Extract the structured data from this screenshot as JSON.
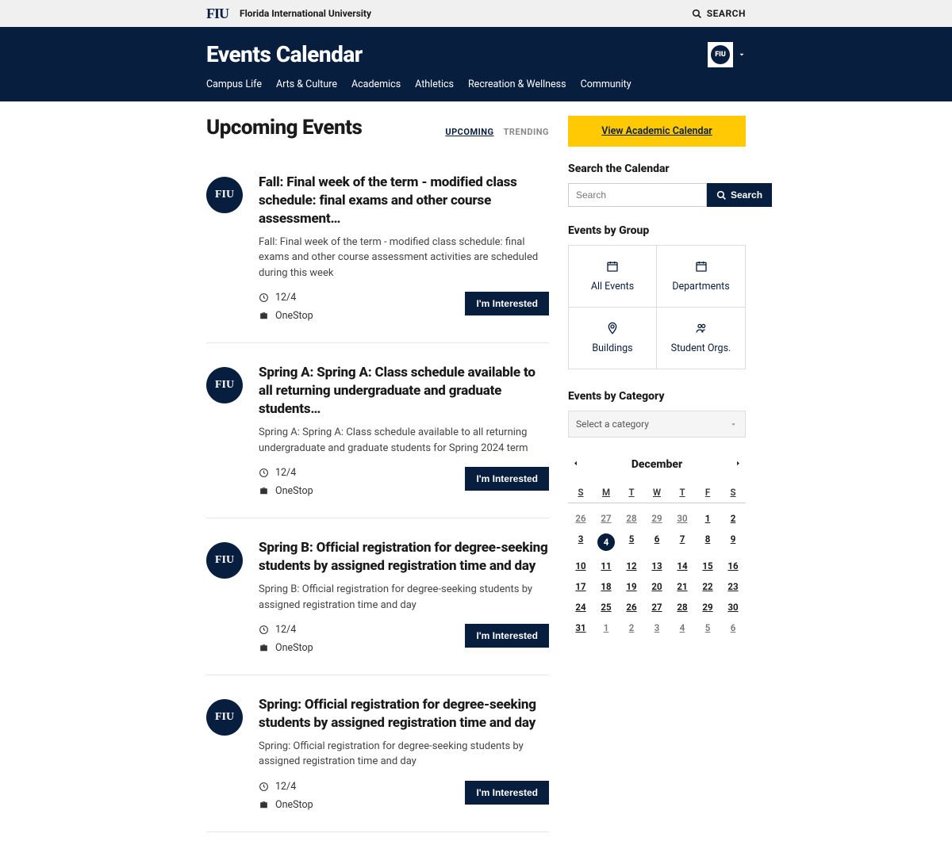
{
  "topbar": {
    "logo_text": "FIU",
    "university_name": "Florida International University",
    "search_label": "SEARCH"
  },
  "header": {
    "site_title": "Events Calendar",
    "avatar_text": "FIU",
    "nav": [
      "Campus Life",
      "Arts & Culture",
      "Academics",
      "Athletics",
      "Recreation & Wellness",
      "Community"
    ]
  },
  "main": {
    "page_title": "Upcoming Events",
    "tabs": {
      "upcoming": "UPCOMING",
      "trending": "TRENDING"
    },
    "events": [
      {
        "title": "Fall: Final week of the term - modified class schedule: final exams and other course assessment…",
        "desc": "Fall: Final week of the term - modified class schedule: final exams and other course assessment activities are scheduled during this week",
        "date": "12/4",
        "org": "OneStop",
        "btn": "I'm Interested"
      },
      {
        "title": "Spring A: Spring A: Class schedule available to all returning undergraduate and graduate students…",
        "desc": "Spring A: Spring A: Class schedule available to all returning undergraduate and graduate students for Spring 2024 term",
        "date": "12/4",
        "org": "OneStop",
        "btn": "I'm Interested"
      },
      {
        "title": "Spring B: Official registration for degree-seeking students by assigned registration time and day",
        "desc": "Spring B: Official registration for degree-seeking students by assigned registration time and day",
        "date": "12/4",
        "org": "OneStop",
        "btn": "I'm Interested"
      },
      {
        "title": "Spring: Official registration for degree-seeking students by assigned registration time and day",
        "desc": "Spring: Official registration for degree-seeking students by assigned registration time and day",
        "date": "12/4",
        "org": "OneStop",
        "btn": "I'm Interested"
      }
    ]
  },
  "sidebar": {
    "academic_btn": "View Academic Calendar",
    "search_heading": "Search the Calendar",
    "search_placeholder": "Search",
    "search_btn": "Search",
    "groups_heading": "Events by Group",
    "groups": [
      "All Events",
      "Departments",
      "Buildings",
      "Student Orgs."
    ],
    "category_heading": "Events by Category",
    "category_placeholder": "Select a category",
    "calendar": {
      "month": "December",
      "dow": [
        "S",
        "M",
        "T",
        "W",
        "T",
        "F",
        "S"
      ],
      "days": [
        {
          "n": "26",
          "muted": true
        },
        {
          "n": "27",
          "muted": true
        },
        {
          "n": "28",
          "muted": true
        },
        {
          "n": "29",
          "muted": true
        },
        {
          "n": "30",
          "muted": true
        },
        {
          "n": "1"
        },
        {
          "n": "2"
        },
        {
          "n": "3"
        },
        {
          "n": "4",
          "today": true
        },
        {
          "n": "5"
        },
        {
          "n": "6"
        },
        {
          "n": "7"
        },
        {
          "n": "8"
        },
        {
          "n": "9"
        },
        {
          "n": "10"
        },
        {
          "n": "11"
        },
        {
          "n": "12"
        },
        {
          "n": "13"
        },
        {
          "n": "14"
        },
        {
          "n": "15"
        },
        {
          "n": "16"
        },
        {
          "n": "17"
        },
        {
          "n": "18"
        },
        {
          "n": "19"
        },
        {
          "n": "20"
        },
        {
          "n": "21"
        },
        {
          "n": "22"
        },
        {
          "n": "23"
        },
        {
          "n": "24"
        },
        {
          "n": "25"
        },
        {
          "n": "26"
        },
        {
          "n": "27"
        },
        {
          "n": "28"
        },
        {
          "n": "29"
        },
        {
          "n": "30"
        },
        {
          "n": "31"
        },
        {
          "n": "1",
          "muted": true
        },
        {
          "n": "2",
          "muted": true
        },
        {
          "n": "3",
          "muted": true
        },
        {
          "n": "4",
          "muted": true
        },
        {
          "n": "5",
          "muted": true
        },
        {
          "n": "6",
          "muted": true
        }
      ]
    }
  }
}
